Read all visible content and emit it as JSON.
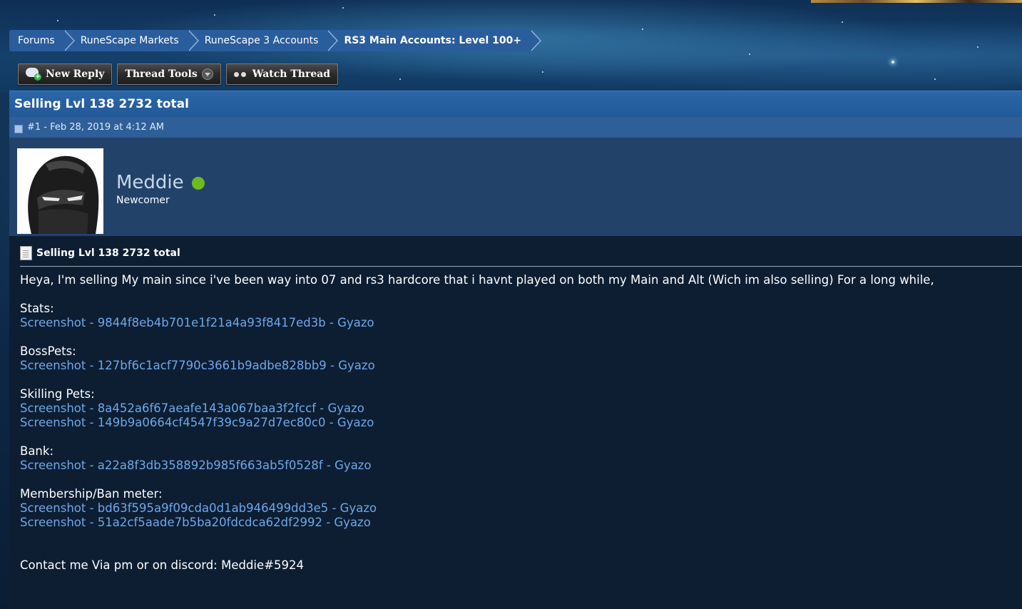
{
  "breadcrumb": [
    {
      "label": "Forums"
    },
    {
      "label": "RuneScape Markets"
    },
    {
      "label": "RuneScape 3 Accounts"
    },
    {
      "label": "RS3 Main Accounts: Level 100+"
    }
  ],
  "toolbar": {
    "new_reply": "New Reply",
    "thread_tools": "Thread Tools",
    "watch_thread": "Watch Thread"
  },
  "thread": {
    "title": "Selling Lvl 138 2732 total"
  },
  "post": {
    "meta": "#1 - Feb 28, 2019 at 4:12 AM",
    "author": {
      "name": "Meddie",
      "title": "Newcomer",
      "status": "online"
    },
    "title": "Selling Lvl 138 2732 total",
    "intro": "Heya, I'm selling My main since i've been way into 07 and rs3 hardcore that i havnt played on both my Main and Alt (Wich im also selling) For a long while,",
    "sections": [
      {
        "heading": "Stats:",
        "links": [
          "Screenshot - 9844f8eb4b701e1f21a4a93f8417ed3b - Gyazo"
        ]
      },
      {
        "heading": "BossPets:",
        "links": [
          "Screenshot - 127bf6c1acf7790c3661b9adbe828bb9 - Gyazo"
        ]
      },
      {
        "heading": "Skilling Pets:",
        "links": [
          "Screenshot - 8a452a6f67aeafe143a067baa3f2fccf - Gyazo",
          "Screenshot - 149b9a0664cf4547f39c9a27d7ec80c0 - Gyazo"
        ]
      },
      {
        "heading": "Bank:",
        "links": [
          "Screenshot - a22a8f3db358892b985f663ab5f0528f - Gyazo"
        ]
      },
      {
        "heading": "Membership/Ban meter:",
        "links": [
          "Screenshot - bd63f595a9f09cda0d1ab946499dd3e5 - Gyazo",
          "Screenshot - 51a2cf5aade7b5ba20fdcdca62df2992 - Gyazo"
        ]
      }
    ],
    "contact": "Contact me Via pm or on discord: Meddie#5924"
  },
  "colors": {
    "accent_blue": "#2a5d9c",
    "link": "#6fa7e8",
    "online": "#6cbb1f",
    "post_bg": "#0d1e33"
  }
}
